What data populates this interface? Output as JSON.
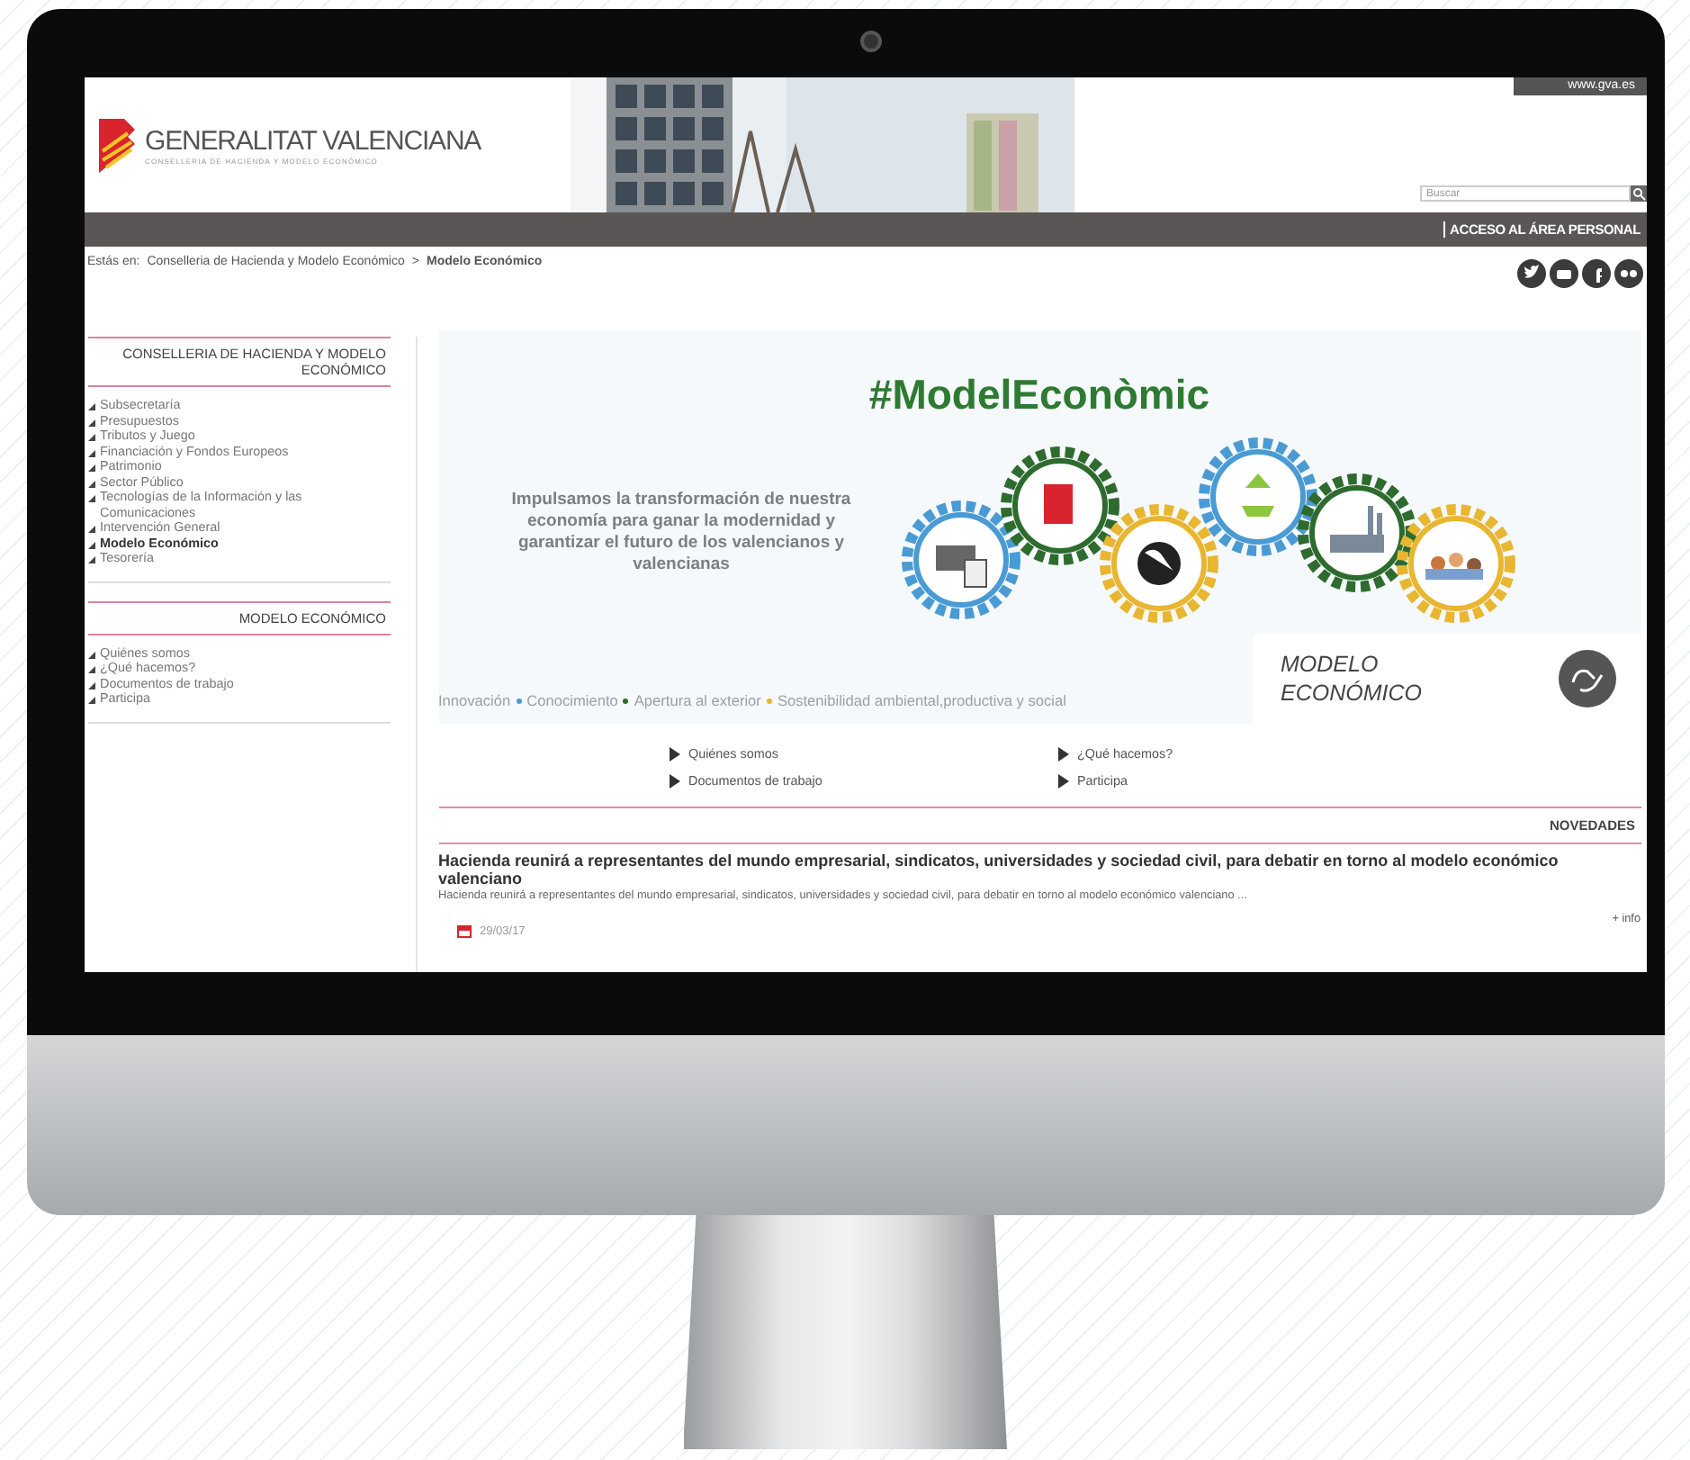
{
  "header": {
    "logo_title": "GENERALITAT VALENCIANA",
    "logo_subtitle": "CONSELLERIA DE HACIENDA Y MODELO ECONÓMICO",
    "site_link": "www.gva.es",
    "search": {
      "placeholder": "Buscar"
    }
  },
  "nav_bar": {
    "link": "ACCESO AL ÁREA PERSONAL"
  },
  "breadcrumb": {
    "label": "Estás en:",
    "separator": ">",
    "items": [
      {
        "text": "Conselleria de Hacienda y Modelo Económico",
        "current": false
      },
      {
        "text": "Modelo Económico",
        "current": true
      }
    ]
  },
  "sidebar": {
    "sections": [
      {
        "title": "CONSELLERIA DE HACIENDA Y MODELO ECONÓMICO",
        "items": [
          {
            "label": "Subsecretaría",
            "selected": false
          },
          {
            "label": "Presupuestos",
            "selected": false
          },
          {
            "label": "Tributos y Juego",
            "selected": false
          },
          {
            "label": "Financiación y Fondos Europeos",
            "selected": false
          },
          {
            "label": "Patrimonio",
            "selected": false
          },
          {
            "label": "Sector Público",
            "selected": false
          },
          {
            "label": "Tecnologías de la Información y las Comunicaciones",
            "selected": false
          },
          {
            "label": "Intervención General",
            "selected": false
          },
          {
            "label": "Modelo Económico",
            "selected": true
          },
          {
            "label": "Tesorería",
            "selected": false
          }
        ]
      },
      {
        "title": "MODELO ECONÓMICO",
        "items": [
          {
            "label": "Quiénes somos",
            "selected": false
          },
          {
            "label": "¿Qué hacemos?",
            "selected": false
          },
          {
            "label": "Documentos de trabajo",
            "selected": false
          },
          {
            "label": "Participa",
            "selected": false
          }
        ]
      }
    ]
  },
  "banner": {
    "hashtag": "#ModelEconòmic",
    "text": "Impulsamos la transformación de nuestra economía para ganar la modernidad y garantizar el futuro de los valencianos y valencianas",
    "tags": [
      {
        "label": "Innovación",
        "color": "#4a9bd4"
      },
      {
        "label": "Conocimiento",
        "color": "#2e6b2e"
      },
      {
        "label": "Apertura al exterior",
        "color": "#e8b630"
      },
      {
        "label": "Sostenibilidad ambiental,productiva y social"
      }
    ],
    "badge": "MODELO ECONÓMICO"
  },
  "quick_links": [
    "Quiénes somos",
    "¿Qué hacemos?",
    "Documentos de trabajo",
    "Participa"
  ],
  "news": {
    "title": "NOVEDADES",
    "items": [
      {
        "headline": "Hacienda reunirá a representantes del mundo empresarial, sindicatos, universidades y sociedad civil, para debatir en torno al modelo económico valenciano",
        "summary": "Hacienda reunirá a representantes del mundo empresarial, sindicatos, universidades y sociedad civil, para debatir en torno al modelo económico valenciano ...",
        "more": "+ info",
        "date": "29/03/17"
      }
    ]
  }
}
